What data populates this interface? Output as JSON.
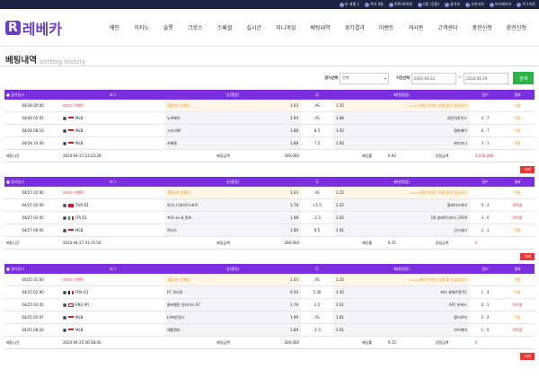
{
  "topbar": {
    "items": [
      "본사"
    ]
  },
  "topbar_items": [
    {
      "icon": "badge-icon",
      "text": "본 레벨 1"
    },
    {
      "icon": "mail-icon",
      "text": "쪽지 0통"
    },
    {
      "icon": "coin-icon",
      "text": "500,000원"
    },
    {
      "icon": "point-icon",
      "text": "0점 (전환)"
    },
    {
      "icon": "checkin-icon",
      "text": "출석부"
    },
    {
      "icon": "recommend-icon",
      "text": "추천내역"
    },
    {
      "icon": "mypage-icon",
      "text": "마이페이지"
    },
    {
      "icon": "logout-icon",
      "text": "로그아웃"
    }
  ],
  "logo": {
    "mark": "R",
    "text": "레베카"
  },
  "nav": [
    "메인",
    "카지노",
    "슬롯",
    "크로스",
    "스페셜",
    "실시간",
    "미니게임",
    "베팅내역",
    "경기결과",
    "이벤트",
    "게시판",
    "고객센터",
    "충전신청",
    "환전신청"
  ],
  "page": {
    "title": "베팅내역",
    "subtitle": "betting history"
  },
  "search": {
    "type_label": "경기선택",
    "type_value": "전체",
    "period_label": "기간선택",
    "from": "2024-04-22",
    "dash": "~",
    "to": "2024-04-29",
    "button": "검색"
  },
  "columns": [
    "경기일시",
    "리그",
    "승(홈팀)",
    "무",
    "패(원정팀)",
    "점수",
    "결과"
  ],
  "summary_labels": {
    "bet_time": "베팅시간",
    "bet_amount": "베팅금액",
    "odds": "배당률",
    "win_amount": "당첨금액"
  },
  "delete_label": "삭제",
  "slips": [
    {
      "rows": [
        {
          "date": "04/28 00:00",
          "league": "보너스 이벤트",
          "flag": "",
          "special": true,
          "home": "3폴더신 운배당",
          "home_odds": "1.03",
          "draw": "VS",
          "away": "=== 배당 이하는 조합 할수 없습니다",
          "away_odds": "1.35",
          "score": "",
          "result": "적중",
          "result_class": "orange"
        },
        {
          "date": "04/28 05:05",
          "league": "MLB",
          "flag": "us",
          "special": false,
          "home": "뉴욕메츠",
          "home_odds": "1.94",
          "draw": "VS",
          "away": "레인저루이스",
          "away_odds": "1.86",
          "score": "4 : 7",
          "result": "적중",
          "result_class": "orange"
        },
        {
          "date": "04/28 08:10",
          "league": "MLB",
          "flag": "us",
          "special": false,
          "home": "시카고W",
          "home_odds": "1.88",
          "draw": "8.5",
          "away": "템파베이",
          "away_odds": "1.92",
          "score": "8 : 7",
          "result": "적중",
          "result_class": "orange"
        },
        {
          "date": "04/28 10:40",
          "league": "MLB",
          "flag": "us",
          "special": false,
          "home": "샤배들",
          "home_odds": "1.88",
          "draw": "7.5",
          "away": "에리조나",
          "away_odds": "1.92",
          "score": "3 : 1",
          "result": "적중",
          "result_class": "orange"
        }
      ],
      "bet_time": "2024-04-27 23:23:28",
      "bet_amount": "300,000",
      "odds": "6.92",
      "win_amount": "2,076,000"
    },
    {
      "rows": [
        {
          "date": "04/27 02:00",
          "league": "보너스 이벤트",
          "flag": "",
          "special": true,
          "home": "3폴더신 운배당",
          "home_odds": "1.03",
          "draw": "VS",
          "away": "=== 배당 이하는 조합 할수 없습니다",
          "away_odds": "1.35",
          "score": "",
          "result": "적중",
          "result_class": "orange"
        },
        {
          "date": "04/27 02:00",
          "league": "TUR D1",
          "flag": "tr",
          "special": false,
          "home": "하다나 데미르스포르",
          "home_odds": "1.78",
          "draw": "+1.5",
          "away": "올바이스파이",
          "away_odds": "2.02",
          "score": "0 : 3",
          "result": "미적중",
          "result_class": "red"
        },
        {
          "date": "04/27 03:45",
          "league": "ITA D1",
          "flag": "it",
          "special": false,
          "home": "프로시노네 칼초",
          "home_odds": "1.98",
          "draw": "-1.5",
          "away": "US 살레르니타나 1919",
          "away_odds": "1.82",
          "score": "3 : 0",
          "result": "미적중",
          "result_class": "red"
        },
        {
          "date": "04/27 09:05",
          "league": "MLB",
          "flag": "us",
          "special": false,
          "home": "텍사스",
          "home_odds": "1.89",
          "draw": "8.5",
          "away": "신시내티",
          "away_odds": "1.91",
          "score": "2 : 1",
          "result": "적중",
          "result_class": "orange"
        }
      ],
      "bet_time": "2024-04-27 01:15:50",
      "bet_amount": "200,000",
      "odds": "6.31",
      "win_amount": "0"
    },
    {
      "rows": [
        {
          "date": "04/25 01:00",
          "league": "보너스 이벤트",
          "flag": "",
          "special": true,
          "home": "3폴더신 운배당",
          "home_odds": "1.03",
          "draw": "VS",
          "away": "=== 배당 이하는 조합 할수 없습니다",
          "away_odds": "1.35",
          "score": "",
          "result": "적중",
          "result_class": "orange"
        },
        {
          "date": "04/25 02:00",
          "league": "FRA D1",
          "flag": "fr",
          "special": false,
          "home": "FC 로리앙",
          "home_odds": "6.50",
          "draw": "5.30",
          "away": "파리 생제르맹 FC",
          "away_odds": "1.45",
          "score": "1 : 4",
          "result": "적중",
          "result_class": "orange"
        },
        {
          "date": "04/25 03:45",
          "league": "ENG PR",
          "flag": "en",
          "special": false,
          "home": "울버햄튼 원더러스 FC",
          "home_odds": "1.79",
          "draw": "2.5",
          "away": "AFC 본머스",
          "away_odds": "2.01",
          "score": "0 : 1",
          "result": "미적중",
          "result_class": "red"
        },
        {
          "date": "04/25 05:07",
          "league": "MLB",
          "flag": "us",
          "special": false,
          "home": "LA에인절스",
          "home_odds": "1.99",
          "draw": "VS",
          "away": "볼티모어",
          "away_odds": "1.81",
          "score": "5 : 4",
          "result": "적중",
          "result_class": "orange"
        },
        {
          "date": "04/25 08:20",
          "league": "MLB",
          "flag": "us",
          "special": false,
          "home": "애틀랜타",
          "home_odds": "1.89",
          "draw": "-1.5",
          "away": "마이애미",
          "away_odds": "1.91",
          "score": "1 : 0",
          "result": "미적중",
          "result_class": "red"
        }
      ],
      "bet_time": "2024-04-25 00:58:40",
      "bet_amount": "200,000",
      "odds": "9.15",
      "win_amount": "0"
    }
  ]
}
